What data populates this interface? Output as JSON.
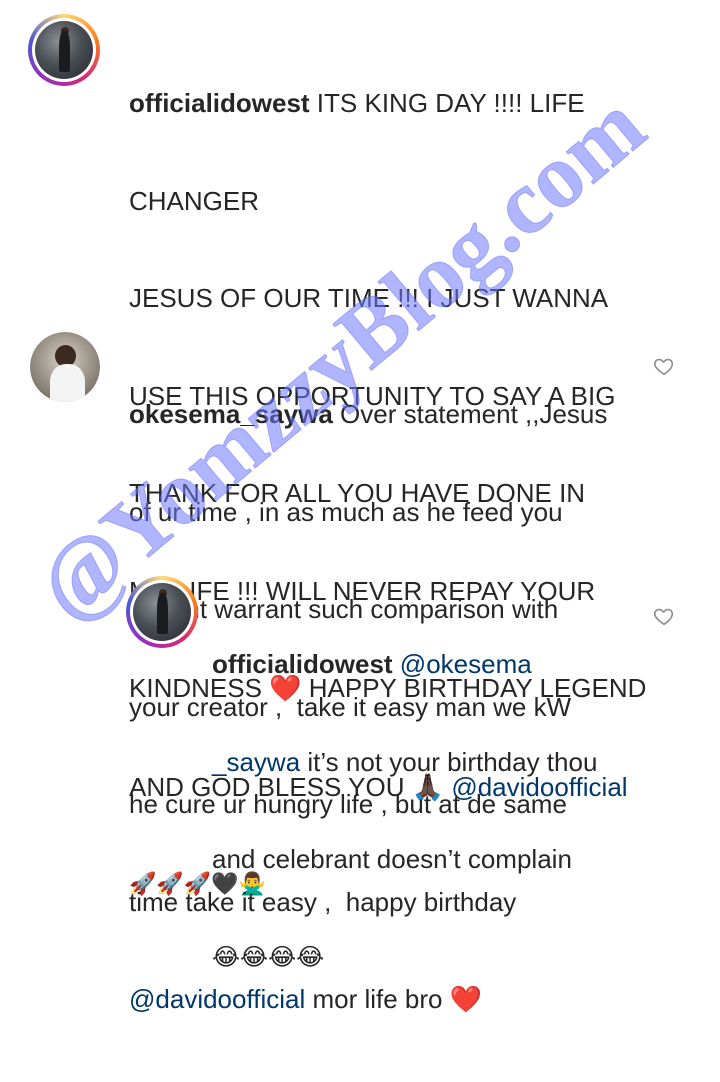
{
  "comments": [
    {
      "username": "officialidowest",
      "line1": " ITS KING DAY !!!! LIFE",
      "lines": [
        "CHANGER",
        "JESUS OF OUR TIME !!! I JUST WANNA",
        "USE THIS OPPORTUNITY TO SAY A BIG",
        "THANK FOR ALL YOU HAVE DONE IN",
        "MY LIFE !!! WILL NEVER REPAY YOUR"
      ],
      "line7a": "KINDNESS ",
      "line7b": " HAPPY BIRTHDAY LEGEND",
      "line8a": "AND GOD BLESS YOU ",
      "mention": "@davidoofficial",
      "emoji_row": "🚀🚀🚀🖤🙅‍♂️",
      "heart_emoji": "❤️",
      "pray_emoji": "🙏🏿"
    },
    {
      "username": "okesema_saywa",
      "line1": " Over statement ,,Jesus",
      "lines": [
        "of ur time , in as much as he feed you",
        "dosent warrant such comparison with",
        "your creator ,  take it easy man we kW",
        "he cure ur hungry life , but at de same",
        "time take it easy ,  happy birthday"
      ],
      "mention": "@davidoofficial",
      "tail": " mor life bro ",
      "heart_emoji": "❤️"
    },
    {
      "username": "officialidowest",
      "mention_a": " @okesema",
      "mention_b": "_saywa",
      "line2_rest": " it’s not your birthday thou",
      "line3": "and celebrant doesn’t complain",
      "emoji_row": "😂😂😂😂"
    }
  ],
  "watermark": "@YomzzyBlog.com",
  "colors": {
    "text": "#262626",
    "mention": "#00376b",
    "watermark": "#6e78ff",
    "heart_outline": "#8e8e8e"
  },
  "icons": [
    "like-heart-icon",
    "like-heart-icon"
  ]
}
